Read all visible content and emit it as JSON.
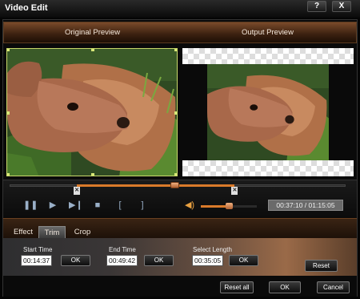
{
  "window": {
    "title": "Video Edit",
    "help_label": "?",
    "close_label": "X"
  },
  "preview": {
    "original_label": "Original Preview",
    "output_label": "Output Preview"
  },
  "playback": {
    "time_display": "00:37:10 / 01:15:05",
    "progress": 0.49,
    "trim_start_fraction": 0.2,
    "trim_end_fraction": 0.67,
    "volume": 0.5,
    "icons": [
      "pause-icon",
      "play-icon",
      "next-frame-icon",
      "stop-icon",
      "mark-start-icon",
      "mark-end-icon",
      "volume-icon"
    ]
  },
  "tabs": [
    {
      "label": "Effect",
      "active": false
    },
    {
      "label": "Trim",
      "active": true
    },
    {
      "label": "Crop",
      "active": false
    }
  ],
  "trim": {
    "start_label": "Start Time",
    "start_value": "00:14:37",
    "end_label": "End Time",
    "end_value": "00:49:42",
    "length_label": "Select Length",
    "length_value": "00:35:05",
    "ok_label": "OK",
    "reset_label": "Reset"
  },
  "footer": {
    "reset_all_label": "Reset all",
    "ok_label": "OK",
    "cancel_label": "Cancel"
  },
  "colors": {
    "accent": "#d97a2a",
    "selection_border": "#c8d86a"
  }
}
